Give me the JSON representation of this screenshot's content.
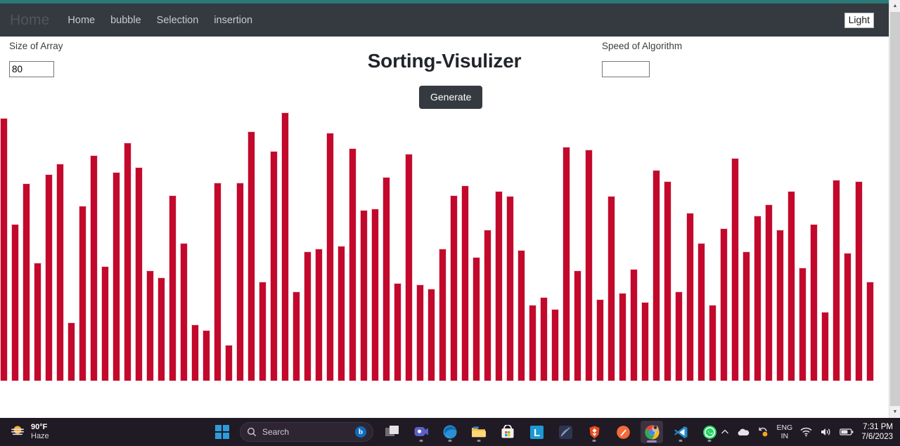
{
  "navbar": {
    "brand": "Home",
    "links": [
      {
        "label": "Home"
      },
      {
        "label": "bubble"
      },
      {
        "label": "Selection"
      },
      {
        "label": "insertion"
      }
    ],
    "theme_button": "Light"
  },
  "controls": {
    "size_label": "Size of Array",
    "size_value": "80",
    "size_placeholder": "",
    "speed_label": "Speed of Algorithm",
    "speed_value": "",
    "speed_placeholder": "",
    "title": "Sorting-Visulizer",
    "generate_label": "Generate"
  },
  "colors": {
    "bar": "#c2092c",
    "navbar": "#343a40",
    "accent_strip": "#2b7a78",
    "button": "#343a40"
  },
  "chart_data": {
    "type": "bar",
    "title": "Sorting-Visulizer",
    "xlabel": "",
    "ylabel": "",
    "grid": false,
    "legend": false,
    "ylim": [
      0,
      390
    ],
    "bar_color": "#c2092c",
    "count": 78,
    "values": [
      382,
      228,
      287,
      172,
      300,
      315,
      85,
      254,
      328,
      166,
      303,
      346,
      310,
      160,
      150,
      270,
      200,
      82,
      74,
      288,
      52,
      288,
      362,
      144,
      334,
      390,
      130,
      188,
      192,
      360,
      196,
      338,
      248,
      250,
      296,
      142,
      330,
      140,
      134,
      192,
      270,
      284,
      180,
      220,
      276,
      268,
      190,
      110,
      122,
      104,
      340,
      160,
      336,
      118,
      268,
      128,
      162,
      114,
      306,
      290,
      130,
      244,
      200,
      110,
      222,
      324,
      188,
      240,
      256,
      220,
      276,
      164,
      228,
      100,
      292,
      186,
      290,
      144
    ]
  },
  "scrollbar": {
    "up_arrow": "▲",
    "down_arrow": "▼"
  },
  "taskbar": {
    "weather": {
      "temp": "90°F",
      "condition": "Haze",
      "icon": "haze-sun-icon"
    },
    "start": "start-button",
    "search": {
      "placeholder": "Search",
      "bing": "b"
    },
    "apps": [
      {
        "name": "task-view"
      },
      {
        "name": "teams"
      },
      {
        "name": "edge"
      },
      {
        "name": "file-explorer"
      },
      {
        "name": "microsoft-store"
      },
      {
        "name": "leetcode"
      },
      {
        "name": "dark-app"
      },
      {
        "name": "brave"
      },
      {
        "name": "postman"
      },
      {
        "name": "chrome"
      },
      {
        "name": "vs-code"
      },
      {
        "name": "whatsapp"
      }
    ],
    "tray": {
      "chevron": "⌃",
      "language_primary": "ENG",
      "language_secondary": "IN",
      "time": "7:31 PM",
      "date": "7/6/2023"
    }
  }
}
